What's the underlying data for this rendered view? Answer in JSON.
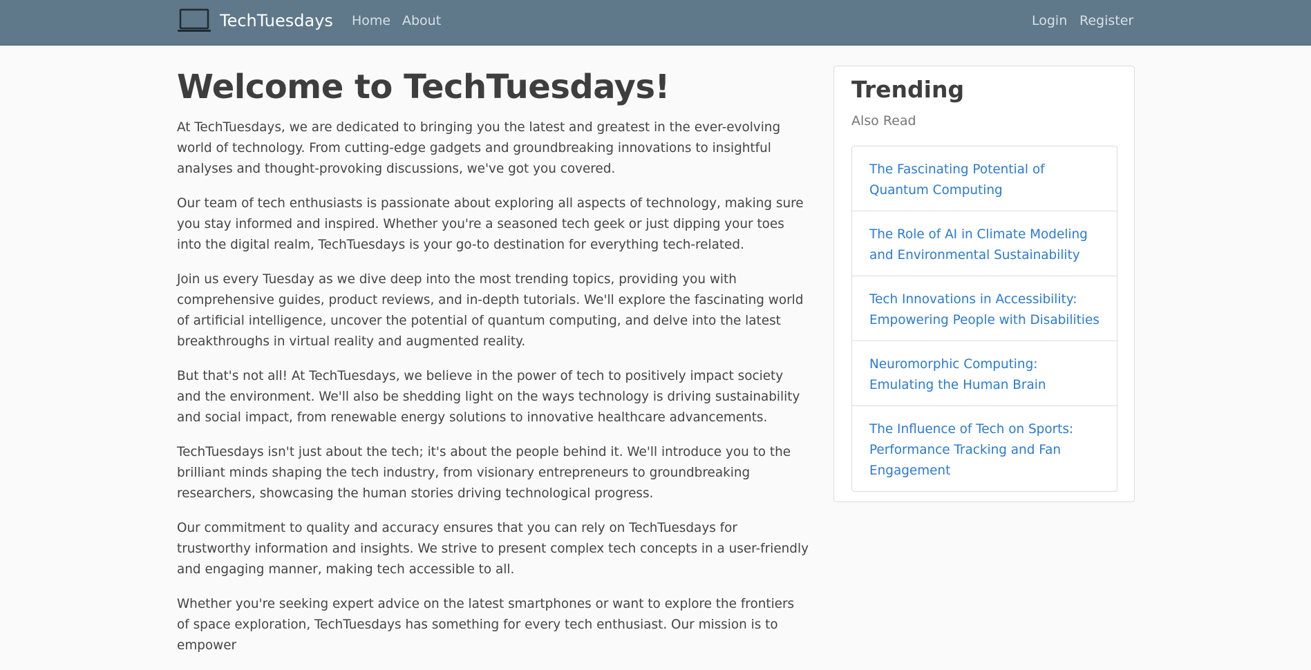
{
  "nav": {
    "brand": "TechTuesdays",
    "brand_icon": "laptop-icon",
    "links_left": [
      "Home",
      "About"
    ],
    "links_right": [
      "Login",
      "Register"
    ]
  },
  "main": {
    "title": "Welcome to TechTuesdays!",
    "paragraphs": [
      "At TechTuesdays, we are dedicated to bringing you the latest and greatest in the ever-evolving world of technology. From cutting-edge gadgets and groundbreaking innovations to insightful analyses and thought-provoking discussions, we've got you covered.",
      "Our team of tech enthusiasts is passionate about exploring all aspects of technology, making sure you stay informed and inspired. Whether you're a seasoned tech geek or just dipping your toes into the digital realm, TechTuesdays is your go-to destination for everything tech-related.",
      "Join us every Tuesday as we dive deep into the most trending topics, providing you with comprehensive guides, product reviews, and in-depth tutorials. We'll explore the fascinating world of artificial intelligence, uncover the potential of quantum computing, and delve into the latest breakthroughs in virtual reality and augmented reality.",
      "But that's not all! At TechTuesdays, we believe in the power of tech to positively impact society and the environment. We'll also be shedding light on the ways technology is driving sustainability and social impact, from renewable energy solutions to innovative healthcare advancements.",
      "TechTuesdays isn't just about the tech; it's about the people behind it. We'll introduce you to the brilliant minds shaping the tech industry, from visionary entrepreneurs to groundbreaking researchers, showcasing the human stories driving technological progress.",
      "Our commitment to quality and accuracy ensures that you can rely on TechTuesdays for trustworthy information and insights. We strive to present complex tech concepts in a user-friendly and engaging manner, making tech accessible to all.",
      "Whether you're seeking expert advice on the latest smartphones or want to explore the frontiers of space exploration, TechTuesdays has something for every tech enthusiast. Our mission is to empower"
    ]
  },
  "sidebar": {
    "title": "Trending",
    "subtitle": "Also Read",
    "items": [
      "The Fascinating Potential of Quantum Computing",
      "The Role of AI in Climate Modeling and Environmental Sustainability",
      "Tech Innovations in Accessibility: Empowering People with Disabilities",
      "Neuromorphic Computing: Emulating the Human Brain",
      "The Influence of Tech on Sports: Performance Tracking and Fan Engagement"
    ]
  },
  "colors": {
    "navbar": "#5f788a",
    "link": "#2a7ad1",
    "background": "#fafafa"
  }
}
